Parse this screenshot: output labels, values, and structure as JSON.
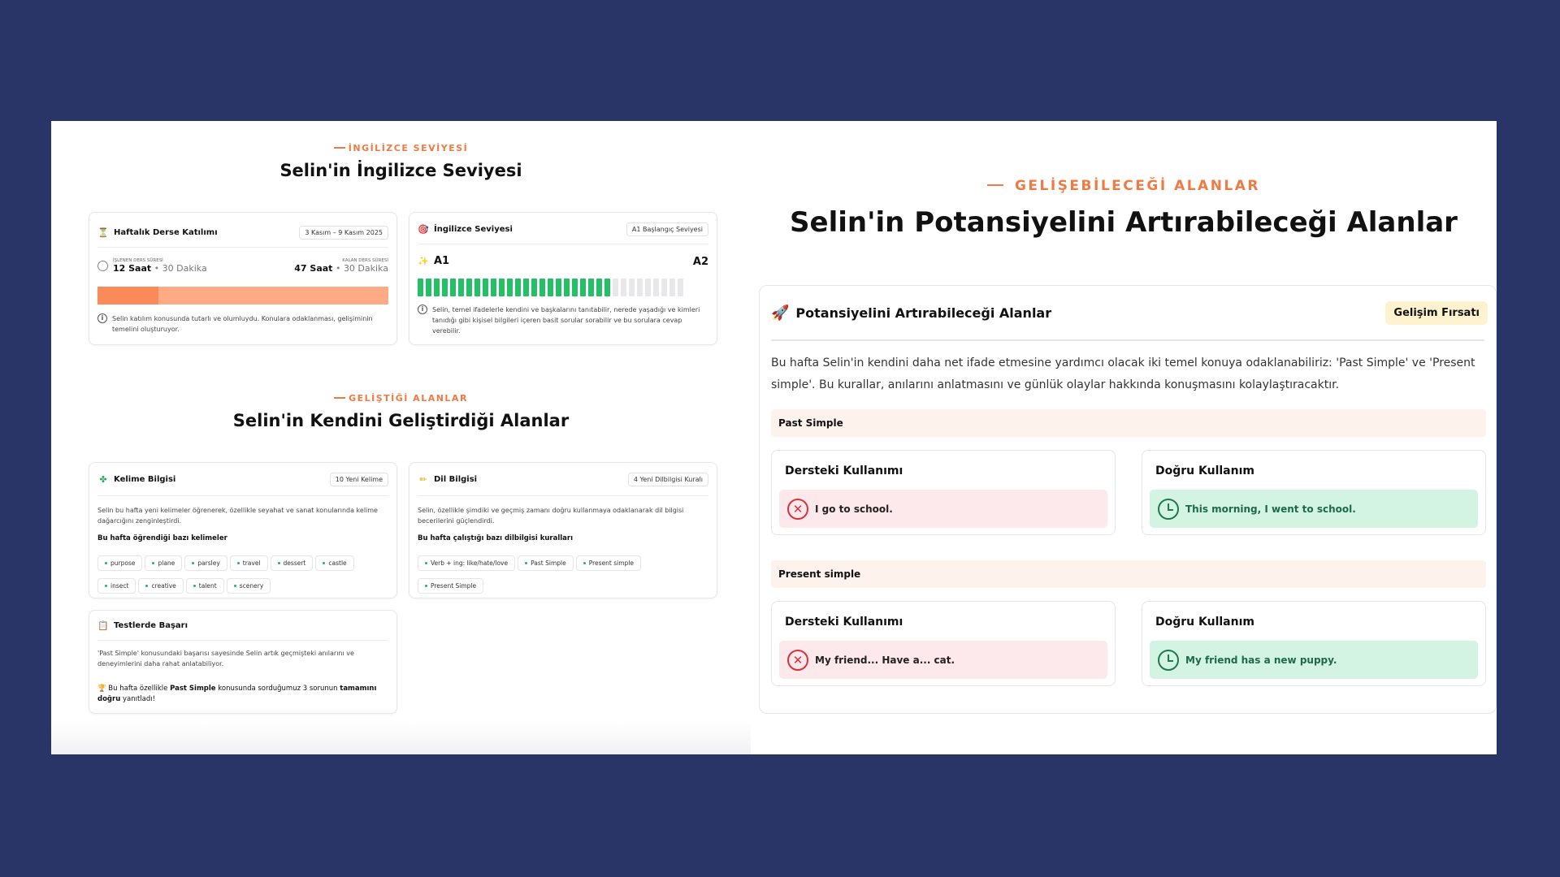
{
  "left": {
    "section1": {
      "eyebrow": "İNGİLİZCE SEVİYESİ",
      "title": "Selin'in İngilizce Seviyesi"
    },
    "attendance": {
      "title": "Haftalık Derse Katılımı",
      "date_chip": "3 Kasım – 9 Kasım 2025",
      "done_label": "İŞLENEN DERS SÜRESİ",
      "done_hours": "12 Saat",
      "done_minutes": "30 Dakika",
      "remaining_label": "KALAN DERS SÜRESİ",
      "remaining_hours": "47 Saat",
      "remaining_minutes": "30 Dakika",
      "progress": 0.21,
      "note": "Selin katılım konusunda tutarlı ve olumluydu. Konulara odaklanması, gelişiminin temelini oluşturuyor."
    },
    "level": {
      "title": "İngilizce Seviyesi",
      "chip": "A1 Başlangıç Seviyesi",
      "from": "A1",
      "to": "A2",
      "filled_segments": 24,
      "total_segments": 33,
      "note": "Selin, temel ifadelerle kendini ve başkalarını tanıtabilir, nerede yaşadığı ve kimleri tanıdığı gibi kişisel bilgileri içeren basit sorular sorabilir ve bu sorulara cevap verebilir."
    },
    "section2": {
      "eyebrow": "GELİŞTİĞİ ALANLAR",
      "title": "Selin'in Kendini Geliştirdiği Alanlar"
    },
    "vocab": {
      "title": "Kelime Bilgisi",
      "chip": "10 Yeni Kelime",
      "text": "Selin bu hafta yeni kelimeler öğrenerek, özellikle seyahat ve sanat konularında kelime dağarcığını zenginleştirdi.",
      "subtitle": "Bu hafta öğrendiği bazı kelimeler",
      "words": [
        "purpose",
        "plane",
        "parsley",
        "travel",
        "dessert",
        "castle",
        "insect",
        "creative",
        "talent",
        "scenery"
      ]
    },
    "grammar": {
      "title": "Dil Bilgisi",
      "chip": "4 Yeni Dilbilgisi Kuralı",
      "text": "Selin, özellikle şimdiki ve geçmiş zamanı doğru kullanmaya odaklanarak dil bilgisi becerilerini güçlendirdi.",
      "subtitle": "Bu hafta çalıştığı bazı dilbilgisi kuralları",
      "rules": [
        "Verb + ing: like/hate/love",
        "Past Simple",
        "Present simple",
        "Present Simple"
      ]
    },
    "tests": {
      "title": "Testlerde Başarı",
      "text": "'Past Simple' konusundaki başarısı sayesinde Selin artık geçmişteki anılarını ve deneyimlerini daha rahat anlatabiliyor.",
      "r1": "Bu hafta özellikle ",
      "r2": "Past Simple",
      "r3": " konusunda sorduğumuz 3 sorunun ",
      "r4": "tamamını doğru",
      "r5": " yanıtladı!"
    }
  },
  "right": {
    "eyebrow": "GELİŞEBİLECEĞİ ALANLAR",
    "title": "Selin'in Potansiyelini Artırabileceği Alanlar",
    "card_title": "Potansiyelini Artırabileceği Alanlar",
    "badge": "Gelişim Fırsatı",
    "paragraph": "Bu hafta Selin'in kendini daha net ifade etmesine yardımcı olacak iki temel konuya odaklanabiliriz: 'Past Simple' ve 'Present simple'. Bu kurallar, anılarını anlatmasını ve günlük olaylar hakkında konuşmasını kolaylaştıracaktır.",
    "in_lesson_label": "Dersteki Kullanımı",
    "correct_label": "Doğru Kullanım",
    "topics": [
      {
        "name": "Past Simple",
        "wrong": "I go to school.",
        "right": "This morning, I went to school."
      },
      {
        "name": "Present simple",
        "wrong": "My friend... Have a... cat.",
        "right": "My friend has a new puppy."
      }
    ]
  },
  "colors": {
    "accent": "#f07a43",
    "bar_dark": "#fa8a5a",
    "bar_light": "#fdab84",
    "segment_on": "#25c065",
    "segment_off": "#e7e7ec"
  },
  "icons": [
    "hourglass-icon",
    "target-icon",
    "clock-icon",
    "sparkle-icon",
    "info-icon",
    "puzzle-icon",
    "pencil-icon",
    "clipboard-icon",
    "trophy-icon",
    "rocket-icon",
    "x-circle-icon"
  ]
}
